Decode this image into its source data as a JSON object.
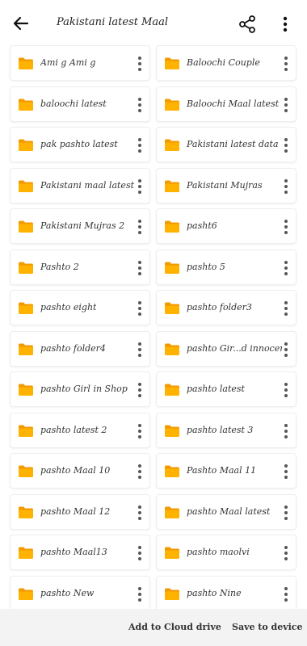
{
  "header": {
    "title": "Pakistani latest Maal"
  },
  "folders": [
    {
      "label": "Ami g Ami g"
    },
    {
      "label": "Baloochi Couple"
    },
    {
      "label": "baloochi latest"
    },
    {
      "label": "Baloochi Maal latest"
    },
    {
      "label": "pak pashto latest"
    },
    {
      "label": "Pakistani latest data"
    },
    {
      "label": "Pakistani maal latest"
    },
    {
      "label": "Pakistani Mujras"
    },
    {
      "label": "Pakistani Mujras 2"
    },
    {
      "label": "pasht6"
    },
    {
      "label": "Pashto 2"
    },
    {
      "label": "pashto 5"
    },
    {
      "label": "pashto eight"
    },
    {
      "label": "pashto folder3"
    },
    {
      "label": "pashto folder4"
    },
    {
      "label": "pashto Gir...d innocent"
    },
    {
      "label": "pashto Girl in Shop"
    },
    {
      "label": "pashto latest"
    },
    {
      "label": "pashto latest 2"
    },
    {
      "label": "pashto latest 3"
    },
    {
      "label": "pashto Maal 10"
    },
    {
      "label": "Pashto Maal 11"
    },
    {
      "label": "pashto Maal 12"
    },
    {
      "label": "pashto Maal latest"
    },
    {
      "label": "pashto Maal13"
    },
    {
      "label": "pashto maolvi"
    },
    {
      "label": "pashto New"
    },
    {
      "label": "pashto Nine"
    }
  ],
  "bottom_bar": {
    "add_cloud_label": "Add to Cloud drive",
    "save_device_label": "Save to device"
  },
  "colors": {
    "folder": "#FFB300",
    "folder_dark": "#F29A00"
  },
  "icons": {
    "back": "arrow-left-icon",
    "share": "share-icon",
    "menu": "more-vert-icon",
    "folder": "folder-icon",
    "item_menu": "more-vert-icon"
  }
}
